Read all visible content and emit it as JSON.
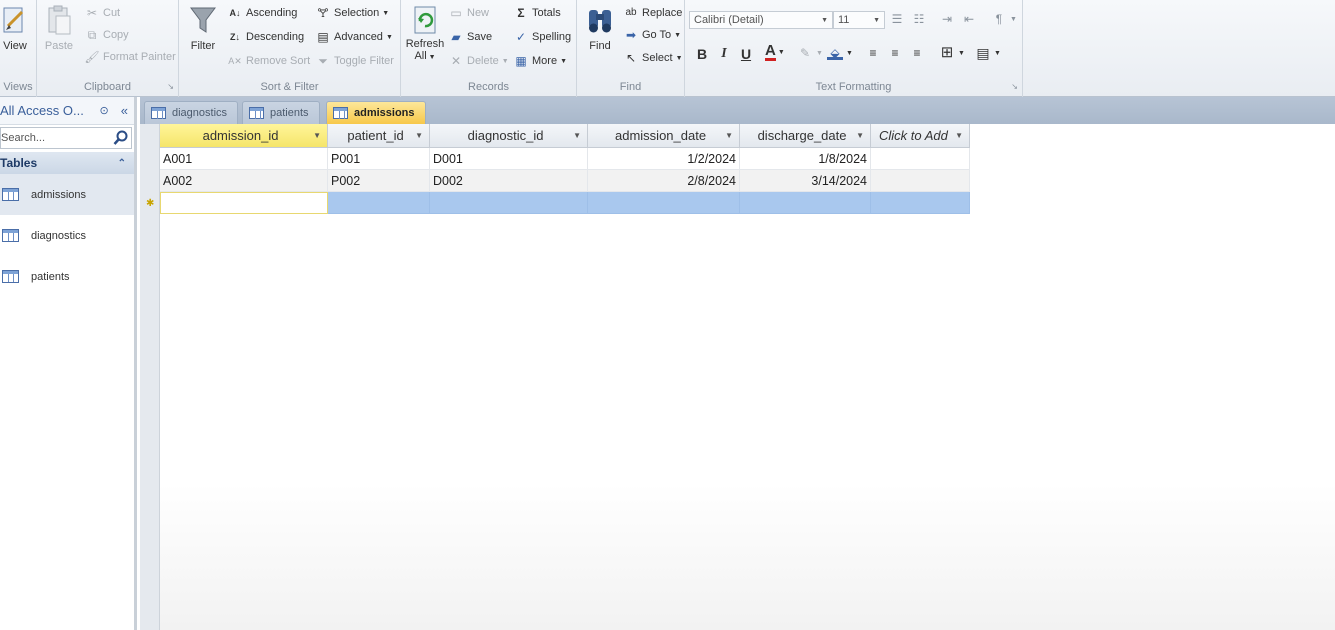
{
  "ribbon": {
    "views": {
      "view_label": "View",
      "group_label": "Views"
    },
    "clipboard": {
      "paste": "Paste",
      "cut": "Cut",
      "copy": "Copy",
      "format_painter": "Format Painter",
      "group_label": "Clipboard"
    },
    "sort_filter": {
      "filter": "Filter",
      "ascending": "Ascending",
      "descending": "Descending",
      "remove_sort": "Remove Sort",
      "selection": "Selection",
      "advanced": "Advanced",
      "toggle_filter": "Toggle Filter",
      "group_label": "Sort & Filter"
    },
    "records": {
      "refresh": "Refresh",
      "refresh_all": "All",
      "new": "New",
      "save": "Save",
      "delete": "Delete",
      "totals": "Totals",
      "spelling": "Spelling",
      "more": "More",
      "group_label": "Records"
    },
    "find": {
      "find": "Find",
      "replace": "Replace",
      "go_to": "Go To",
      "select": "Select",
      "group_label": "Find"
    },
    "text_formatting": {
      "font_name": "Calibri (Detail)",
      "font_size": "11",
      "bold": "B",
      "italic": "I",
      "underline": "U",
      "font_color_glyph": "A",
      "group_label": "Text Formatting",
      "font_color": "#d02020"
    }
  },
  "nav": {
    "title": "All Access O...",
    "search_placeholder": "Search...",
    "category": "Tables",
    "items": [
      {
        "label": "admissions"
      },
      {
        "label": "diagnostics"
      },
      {
        "label": "patients"
      }
    ]
  },
  "tabs": [
    {
      "label": "diagnostics"
    },
    {
      "label": "patients"
    },
    {
      "label": "admissions"
    }
  ],
  "table": {
    "columns": [
      "admission_id",
      "patient_id",
      "diagnostic_id",
      "admission_date",
      "discharge_date",
      "Click to Add"
    ],
    "rows": [
      [
        "A001",
        "P001",
        "D001",
        "1/2/2024",
        "1/8/2024"
      ],
      [
        "A002",
        "P002",
        "D002",
        "2/8/2024",
        "3/14/2024"
      ]
    ]
  }
}
